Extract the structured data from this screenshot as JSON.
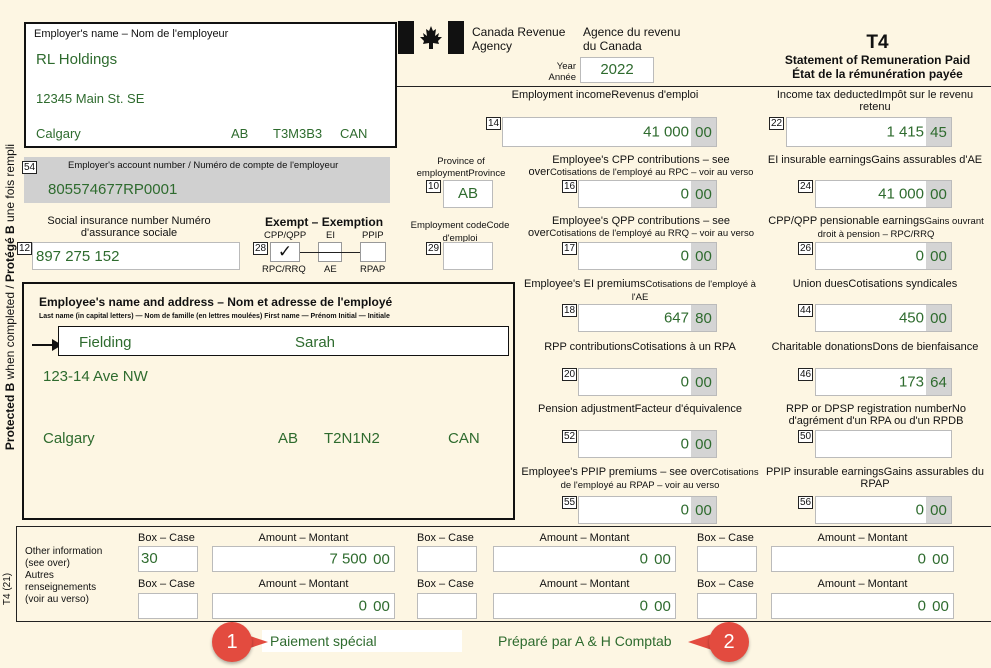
{
  "side_text": {
    "pre": "Protected B",
    "mid": " when completed / ",
    "bold2": "Protégé B",
    "post": " une fois rempli"
  },
  "form_code": "T4 (21)",
  "agency": {
    "en_line1": "Canada Revenue",
    "en_line2": "Agency",
    "fr_line1": "Agence du revenu",
    "fr_line2": "du Canada"
  },
  "year": {
    "label_en": "Year",
    "label_fr": "Année",
    "value": "2022"
  },
  "title": {
    "code": "T4",
    "en": "Statement of Remuneration Paid",
    "fr": "État de la rémunération payée"
  },
  "employer": {
    "label": "Employer's name – Nom de l'employeur",
    "name": "RL Holdings",
    "street": "12345 Main St. SE",
    "city": "Calgary",
    "province": "AB",
    "postal": "T3M3B3",
    "country": "CAN"
  },
  "account": {
    "box": "54",
    "label": "Employer's account number / Numéro de compte de l'employeur",
    "value": "805574677RP0001"
  },
  "province_emp": {
    "label_en": "Province of employment",
    "label_fr": "Province d'emploi",
    "box": "10",
    "value": "AB"
  },
  "sin": {
    "label": "Social insurance number Numéro d'assurance sociale",
    "box": "12",
    "value": "897 275 152"
  },
  "exempt": {
    "title": "Exempt – Exemption",
    "box": "28",
    "cpp_top": "CPP/QPP",
    "cpp_bottom": "RPC/RRQ",
    "cpp_mark": "✓",
    "ei_top": "EI",
    "ei_bottom": "AE",
    "ppip_top": "PPIP",
    "ppip_bottom": "RPAP"
  },
  "emp_code": {
    "label_en": "Employment code",
    "label_fr": "Code d'emploi",
    "box": "29"
  },
  "employee": {
    "title": "Employee's name and address – Nom et adresse de l'employé",
    "subtitle": "Last name (in capital letters) — Nom de famille (en lettres moulées) First name — Prénom Initial — Initiale",
    "last": "Fielding",
    "first": "Sarah",
    "street": "123-14 Ave NW",
    "city": "Calgary",
    "province": "AB",
    "postal": "T2N1N2",
    "country": "CAN"
  },
  "boxes": {
    "b14": {
      "en": "Employment income",
      "fr": "Revenus d'emploi",
      "num": "14",
      "dollars": "41 000",
      "cents": "00"
    },
    "b22": {
      "en": "Income tax deducted",
      "fr": "Impôt sur le revenu retenu",
      "num": "22",
      "dollars": "1 415",
      "cents": "45"
    },
    "b16": {
      "en": "Employee's CPP contributions – see over",
      "fr": "Cotisations de l'employé au RPC – voir au verso",
      "num": "16",
      "dollars": "0",
      "cents": "00"
    },
    "b24": {
      "en": "EI insurable earnings",
      "fr": "Gains assurables d'AE",
      "num": "24",
      "dollars": "41 000",
      "cents": "00"
    },
    "b17": {
      "en": "Employee's QPP contributions – see over",
      "fr": "Cotisations de l'employé au RRQ – voir au verso",
      "num": "17",
      "dollars": "0",
      "cents": "00"
    },
    "b26": {
      "en": "CPP/QPP pensionable earnings",
      "fr": "Gains ouvrant droit à pension – RPC/RRQ",
      "num": "26",
      "dollars": "0",
      "cents": "00"
    },
    "b18": {
      "en": "Employee's EI premiums",
      "fr": "Cotisations de l'employé à l'AE",
      "num": "18",
      "dollars": "647",
      "cents": "80"
    },
    "b44": {
      "en": "Union dues",
      "fr": "Cotisations syndicales",
      "num": "44",
      "dollars": "450",
      "cents": "00"
    },
    "b20": {
      "en": "RPP contributions",
      "fr": "Cotisations à un RPA",
      "num": "20",
      "dollars": "0",
      "cents": "00"
    },
    "b46": {
      "en": "Charitable donations",
      "fr": "Dons de bienfaisance",
      "num": "46",
      "dollars": "173",
      "cents": "64"
    },
    "b52": {
      "en": "Pension adjustment",
      "fr": "Facteur d'équivalence",
      "num": "52",
      "dollars": "0",
      "cents": "00"
    },
    "b50": {
      "en": "RPP or DPSP registration number",
      "fr": "No d'agrément d'un RPA ou d'un RPDB",
      "num": "50"
    },
    "b55": {
      "en": "Employee's PPIP premiums – see over",
      "fr": "Cotisations de l'employé au RPAP – voir au verso",
      "num": "55",
      "dollars": "0",
      "cents": "00"
    },
    "b56": {
      "en": "PPIP insurable earnings",
      "fr": "Gains assurables du RPAP",
      "num": "56",
      "dollars": "0",
      "cents": "00"
    }
  },
  "other": {
    "label_en1": "Other information",
    "label_en2": "(see over)",
    "label_fr1": "Autres",
    "label_fr2": "renseignements",
    "label_fr3": "(voir au verso)",
    "box_label": "Box – Case",
    "amount_label": "Amount – Montant",
    "rows": [
      [
        {
          "box": "30",
          "dollars": "7 500",
          "cents": "00"
        },
        {
          "box": "",
          "dollars": "0",
          "cents": "00"
        },
        {
          "box": "",
          "dollars": "0",
          "cents": "00"
        }
      ],
      [
        {
          "box": "",
          "dollars": "0",
          "cents": "00"
        },
        {
          "box": "",
          "dollars": "0",
          "cents": "00"
        },
        {
          "box": "",
          "dollars": "0",
          "cents": "00"
        }
      ]
    ]
  },
  "footer": {
    "left_text": "Paiement spécial",
    "right_text": "Préparé par A & H Comptab",
    "callout1": "1",
    "callout2": "2"
  },
  "colors": {
    "data_text": "#2e6b2e",
    "callout": "#e34b3f",
    "page_bg": "#fdf6e3"
  }
}
